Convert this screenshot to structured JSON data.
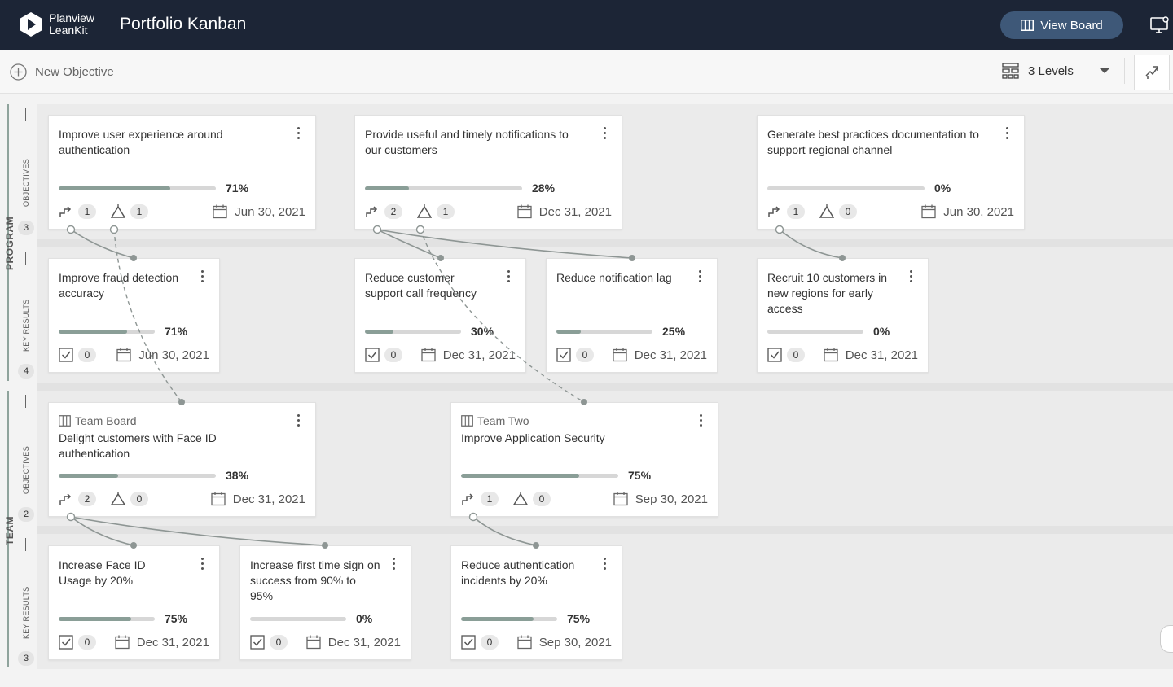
{
  "header": {
    "brand_line1": "Planview",
    "brand_line2": "LeanKit",
    "title": "Portfolio Kanban",
    "view_board_label": "View Board"
  },
  "toolbar": {
    "new_objective_label": "New Objective",
    "levels_label": "3 Levels"
  },
  "sidebar": {
    "program_label": "PROGRAM",
    "team_label": "TEAM",
    "objectives_label": "OBJECTIVES",
    "key_results_label": "KEY RESULTS",
    "program_objectives_count": "3",
    "program_key_results_count": "4",
    "team_objectives_count": "2",
    "team_key_results_count": "3"
  },
  "cards": {
    "p_obj_1": {
      "title": "Improve user experience around authentication",
      "progress": 71,
      "pct": "71%",
      "children": "1",
      "people": "1",
      "date": "Jun 30, 2021"
    },
    "p_obj_2": {
      "title": "Provide useful and timely notifications to our customers",
      "progress": 28,
      "pct": "28%",
      "children": "2",
      "people": "1",
      "date": "Dec 31, 2021"
    },
    "p_obj_3": {
      "title": "Generate best practices documentation to support regional channel",
      "progress": 0,
      "pct": "0%",
      "children": "1",
      "people": "0",
      "date": "Jun 30, 2021"
    },
    "p_kr_1": {
      "title": "Improve fraud detection accuracy",
      "progress": 71,
      "pct": "71%",
      "tasks": "0",
      "date": "Jun 30, 2021"
    },
    "p_kr_2": {
      "title": "Reduce customer support call frequency",
      "progress": 30,
      "pct": "30%",
      "tasks": "0",
      "date": "Dec 31, 2021"
    },
    "p_kr_3": {
      "title": "Reduce notification lag",
      "progress": 25,
      "pct": "25%",
      "tasks": "0",
      "date": "Dec 31, 2021"
    },
    "p_kr_4": {
      "title": "Recruit 10 customers in new regions for early access",
      "progress": 0,
      "pct": "0%",
      "tasks": "0",
      "date": "Dec 31, 2021"
    },
    "t_obj_1": {
      "team": "Team Board",
      "title": "Delight customers with Face ID authentication",
      "progress": 38,
      "pct": "38%",
      "children": "2",
      "people": "0",
      "date": "Dec 31, 2021"
    },
    "t_obj_2": {
      "team": "Team Two",
      "title": "Improve Application Security",
      "progress": 75,
      "pct": "75%",
      "children": "1",
      "people": "0",
      "date": "Sep 30, 2021"
    },
    "t_kr_1": {
      "title": "Increase Face ID Usage by 20%",
      "progress": 75,
      "pct": "75%",
      "tasks": "0",
      "date": "Dec 31, 2021"
    },
    "t_kr_2": {
      "title": "Increase first time sign on success from 90% to 95%",
      "progress": 0,
      "pct": "0%",
      "tasks": "0",
      "date": "Dec 31, 2021"
    },
    "t_kr_3": {
      "title": "Reduce authentication incidents by 20%",
      "progress": 75,
      "pct": "75%",
      "tasks": "0",
      "date": "Sep 30, 2021"
    }
  },
  "colors": {
    "topbar": "#1c2536",
    "accent_button": "#3e5878",
    "progress_fill": "#8a9e97",
    "progress_track": "#d7d7d7",
    "connector": "#8e9694"
  }
}
